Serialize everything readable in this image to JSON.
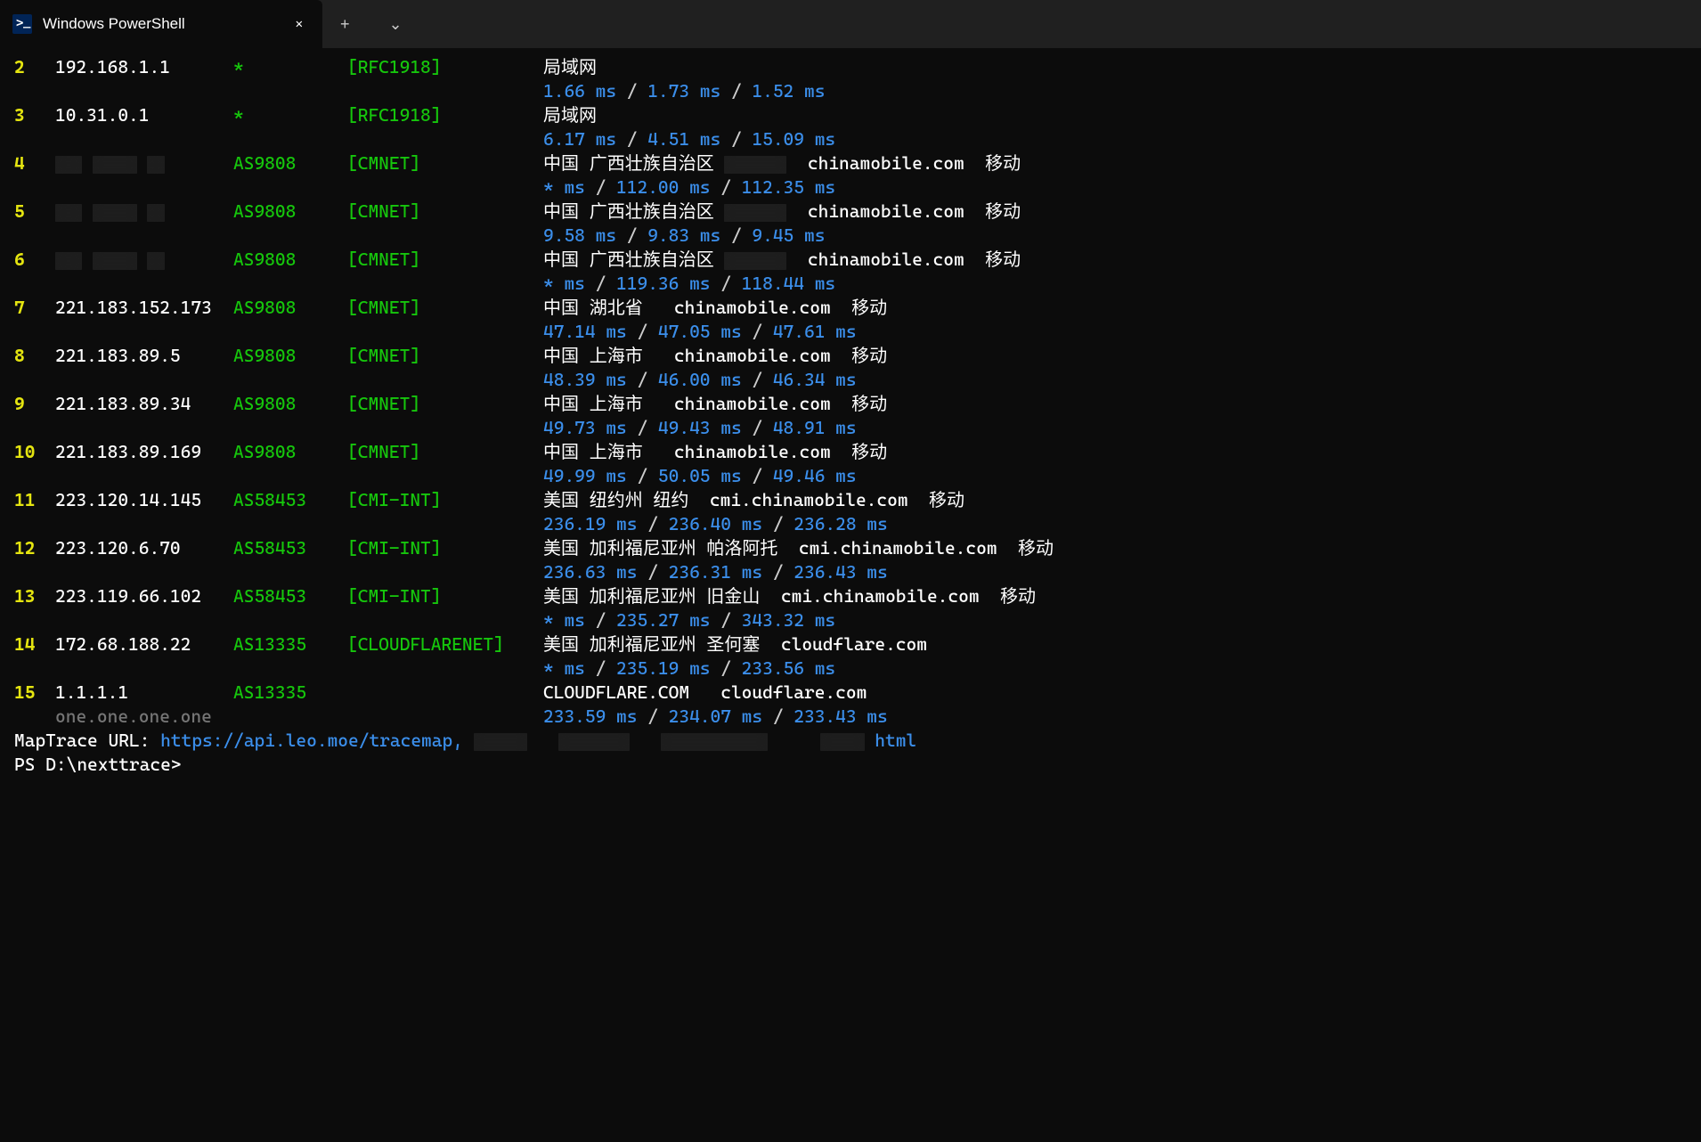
{
  "window": {
    "tab_title": "Windows PowerShell"
  },
  "hops": [
    {
      "n": "2",
      "ip": "192.168.1.1",
      "asn": "*",
      "net": "[RFC1918]",
      "geo": "局域网",
      "domain": "",
      "carrier": "",
      "lat": [
        "1.66 ms",
        "1.73 ms",
        "1.52 ms"
      ],
      "ip_redacted": false,
      "geo_redacted": false
    },
    {
      "n": "3",
      "ip": "10.31.0.1",
      "asn": "*",
      "net": "[RFC1918]",
      "geo": "局域网",
      "domain": "",
      "carrier": "",
      "lat": [
        "6.17 ms",
        "4.51 ms",
        "15.09 ms"
      ],
      "ip_redacted": false,
      "geo_redacted": false
    },
    {
      "n": "4",
      "ip": "",
      "asn": "AS9808",
      "net": "[CMNET]",
      "geo": "中国 广西壮族自治区 ",
      "domain": "chinamobile.com",
      "carrier": "移动",
      "lat": [
        "* ms",
        "112.00 ms",
        "112.35 ms"
      ],
      "ip_redacted": true,
      "geo_redacted": true
    },
    {
      "n": "5",
      "ip": "",
      "asn": "AS9808",
      "net": "[CMNET]",
      "geo": "中国 广西壮族自治区 ",
      "domain": "chinamobile.com",
      "carrier": "移动",
      "lat": [
        "9.58 ms",
        "9.83 ms",
        "9.45 ms"
      ],
      "ip_redacted": true,
      "geo_redacted": true
    },
    {
      "n": "6",
      "ip": "",
      "asn": "AS9808",
      "net": "[CMNET]",
      "geo": "中国 广西壮族自治区 ",
      "domain": "chinamobile.com",
      "carrier": "移动",
      "lat": [
        "* ms",
        "119.36 ms",
        "118.44 ms"
      ],
      "ip_redacted": true,
      "geo_redacted": true
    },
    {
      "n": "7",
      "ip": "221.183.152.173",
      "asn": "AS9808",
      "net": "[CMNET]",
      "geo": "中国 湖北省   ",
      "domain": "chinamobile.com",
      "carrier": "移动",
      "lat": [
        "47.14 ms",
        "47.05 ms",
        "47.61 ms"
      ],
      "ip_redacted": false,
      "geo_redacted": false
    },
    {
      "n": "8",
      "ip": "221.183.89.5",
      "asn": "AS9808",
      "net": "[CMNET]",
      "geo": "中国 上海市   ",
      "domain": "chinamobile.com",
      "carrier": "移动",
      "lat": [
        "48.39 ms",
        "46.00 ms",
        "46.34 ms"
      ],
      "ip_redacted": false,
      "geo_redacted": false
    },
    {
      "n": "9",
      "ip": "221.183.89.34",
      "asn": "AS9808",
      "net": "[CMNET]",
      "geo": "中国 上海市   ",
      "domain": "chinamobile.com",
      "carrier": "移动",
      "lat": [
        "49.73 ms",
        "49.43 ms",
        "48.91 ms"
      ],
      "ip_redacted": false,
      "geo_redacted": false
    },
    {
      "n": "10",
      "ip": "221.183.89.169",
      "asn": "AS9808",
      "net": "[CMNET]",
      "geo": "中国 上海市   ",
      "domain": "chinamobile.com",
      "carrier": "移动",
      "lat": [
        "49.99 ms",
        "50.05 ms",
        "49.46 ms"
      ],
      "ip_redacted": false,
      "geo_redacted": false
    },
    {
      "n": "11",
      "ip": "223.120.14.145",
      "asn": "AS58453",
      "net": "[CMI-INT]",
      "geo": "美国 纽约州 纽约  ",
      "domain": "cmi.chinamobile.com",
      "carrier": "移动",
      "lat": [
        "236.19 ms",
        "236.40 ms",
        "236.28 ms"
      ],
      "ip_redacted": false,
      "geo_redacted": false
    },
    {
      "n": "12",
      "ip": "223.120.6.70",
      "asn": "AS58453",
      "net": "[CMI-INT]",
      "geo": "美国 加利福尼亚州 帕洛阿托  ",
      "domain": "cmi.chinamobile.com",
      "carrier": "移动",
      "lat": [
        "236.63 ms",
        "236.31 ms",
        "236.43 ms"
      ],
      "ip_redacted": false,
      "geo_redacted": false
    },
    {
      "n": "13",
      "ip": "223.119.66.102",
      "asn": "AS58453",
      "net": "[CMI-INT]",
      "geo": "美国 加利福尼亚州 旧金山  ",
      "domain": "cmi.chinamobile.com",
      "carrier": "移动",
      "lat": [
        "* ms",
        "235.27 ms",
        "343.32 ms"
      ],
      "ip_redacted": false,
      "geo_redacted": false
    },
    {
      "n": "14",
      "ip": "172.68.188.22",
      "asn": "AS13335",
      "net": "[CLOUDFLARENET]",
      "geo": "美国 加利福尼亚州 圣何塞  ",
      "domain": "cloudflare.com",
      "carrier": "",
      "lat": [
        "* ms",
        "235.19 ms",
        "233.56 ms"
      ],
      "ip_redacted": false,
      "geo_redacted": false
    },
    {
      "n": "15",
      "ip": "1.1.1.1",
      "asn": "AS13335",
      "net": "",
      "geo": "CLOUDFLARE.COM   ",
      "domain": "cloudflare.com",
      "carrier": "",
      "lat": [
        "233.59 ms",
        "234.07 ms",
        "233.43 ms"
      ],
      "ip_redacted": false,
      "geo_redacted": false,
      "rdns": "one.one.one.one"
    }
  ],
  "footer": {
    "map_label": "MapTrace URL: ",
    "map_url": "https://api.leo.moe/tracemap,",
    "map_suffix": "html",
    "prompt": "PS D:\\nexttrace>"
  }
}
